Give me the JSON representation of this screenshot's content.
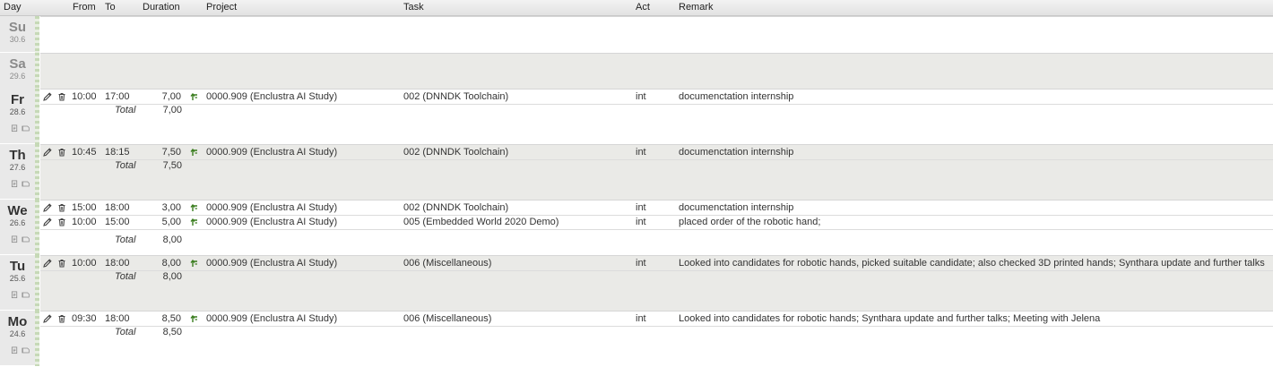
{
  "columns": {
    "day": "Day",
    "from": "From",
    "to": "To",
    "duration": "Duration",
    "project": "Project",
    "task": "Task",
    "act": "Act",
    "remark": "Remark"
  },
  "total_label": "Total",
  "icons": {
    "edit": "pencil-icon",
    "delete": "trash-icon",
    "project": "up-arrow-icon",
    "day_copy": "copy-icon",
    "day_book": "book-icon"
  },
  "colors": {
    "weekday_bg": "#e9e9e9",
    "row_alt_bg": "#eaeae7",
    "row_bg": "#ffffff",
    "accent_strip": "#c6d9b7",
    "project_icon": "#3a7d1e"
  },
  "days": [
    {
      "abbr": "Su",
      "date": "30.6",
      "weekend": true,
      "entries": []
    },
    {
      "abbr": "Sa",
      "date": "29.6",
      "weekend": true,
      "entries": []
    },
    {
      "abbr": "Fr",
      "date": "28.6",
      "weekend": false,
      "total": "7,00",
      "entries": [
        {
          "from": "10:00",
          "to": "17:00",
          "duration": "7,00",
          "project": "0000.909 (Enclustra AI Study)",
          "task": "002 (DNNDK Toolchain)",
          "act": "int",
          "remark": "documenctation internship"
        }
      ]
    },
    {
      "abbr": "Th",
      "date": "27.6",
      "weekend": false,
      "total": "7,50",
      "entries": [
        {
          "from": "10:45",
          "to": "18:15",
          "duration": "7,50",
          "project": "0000.909 (Enclustra AI Study)",
          "task": "002 (DNNDK Toolchain)",
          "act": "int",
          "remark": "documenctation internship"
        }
      ]
    },
    {
      "abbr": "We",
      "date": "26.6",
      "weekend": false,
      "total": "8,00",
      "entries": [
        {
          "from": "15:00",
          "to": "18:00",
          "duration": "3,00",
          "project": "0000.909 (Enclustra AI Study)",
          "task": "002 (DNNDK Toolchain)",
          "act": "int",
          "remark": "documenctation internship"
        },
        {
          "from": "10:00",
          "to": "15:00",
          "duration": "5,00",
          "project": "0000.909 (Enclustra AI Study)",
          "task": "005 (Embedded World 2020 Demo)",
          "act": "int",
          "remark": "placed order of the robotic hand;"
        }
      ]
    },
    {
      "abbr": "Tu",
      "date": "25.6",
      "weekend": false,
      "total": "8,00",
      "entries": [
        {
          "from": "10:00",
          "to": "18:00",
          "duration": "8,00",
          "project": "0000.909 (Enclustra AI Study)",
          "task": "006 (Miscellaneous)",
          "act": "int",
          "remark": "Looked into candidates for robotic hands, picked suitable candidate; also checked 3D printed hands; Synthara update and further talks"
        }
      ]
    },
    {
      "abbr": "Mo",
      "date": "24.6",
      "weekend": false,
      "total": "8,50",
      "entries": [
        {
          "from": "09:30",
          "to": "18:00",
          "duration": "8,50",
          "project": "0000.909 (Enclustra AI Study)",
          "task": "006 (Miscellaneous)",
          "act": "int",
          "remark": "Looked into candidates for robotic hands; Synthara update and further talks; Meeting with Jelena"
        }
      ]
    }
  ]
}
